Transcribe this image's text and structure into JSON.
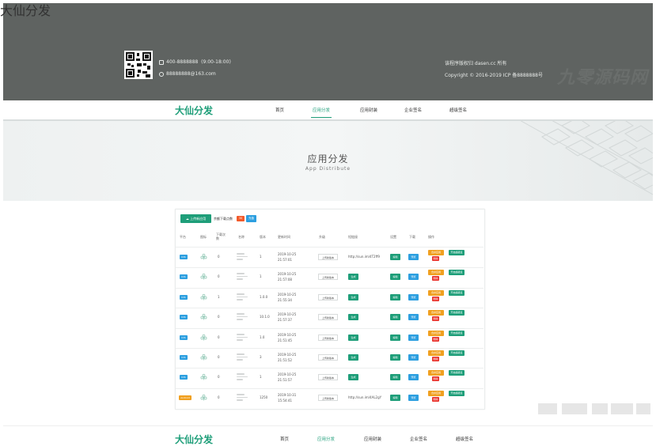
{
  "footer": {
    "brand": "大仙分发",
    "phone": "400-8888888",
    "hours": "(9:00-18:00)",
    "email": "88888888@163.com",
    "rights": "该程序版权归 dasen.cc 所有",
    "copyright": "Copyright © 2016-2019  ICP 备8888888号",
    "watermark": "九零源码网",
    "text_color": "#e8ebe9",
    "bg_color": "#5f6361"
  },
  "nav": {
    "logo": "大仙分发",
    "items": [
      "首页",
      "应用分发",
      "应用封装",
      "企业签名",
      "超级签名"
    ],
    "active_index": 1,
    "accent": "#1e9e79"
  },
  "banner": {
    "title": "应用分发",
    "subtitle": "App Distribute"
  },
  "toolbar": {
    "upload_label": "上传新应用",
    "remaining_text": "余额下载点数",
    "remaining_badge": "30",
    "recharge_label": "充值"
  },
  "table": {
    "headers": [
      "平台",
      "图标",
      "下载次数",
      "名称",
      "版本",
      "更新时间",
      "升级",
      "短链接",
      "设置",
      "下载",
      "操作"
    ],
    "rows": [
      {
        "platform": "IOS",
        "downloads": "0",
        "version": "1",
        "updated_date": "2019-10-25",
        "updated_time": "21:57:01",
        "upgrade": "上传新版本",
        "short": "http://sun.im/4T2ff9",
        "has_link": true
      },
      {
        "platform": "IOS",
        "downloads": "0",
        "version": "1",
        "updated_date": "2019-10-25",
        "updated_time": "21:57:08",
        "upgrade": "上传新版本",
        "short": "生成",
        "has_link": false
      },
      {
        "platform": "IOS",
        "downloads": "1",
        "version": "1.0.0",
        "updated_date": "2019-10-25",
        "updated_time": "21:55:34",
        "upgrade": "上传新版本",
        "short": "生成",
        "has_link": false
      },
      {
        "platform": "IOS",
        "downloads": "0",
        "version": "10.1.0",
        "updated_date": "2019-10-25",
        "updated_time": "21:57:37",
        "upgrade": "上传新版本",
        "short": "生成",
        "has_link": false
      },
      {
        "platform": "IOS",
        "downloads": "0",
        "version": "1.0",
        "updated_date": "2019-10-25",
        "updated_time": "21:51:45",
        "upgrade": "上传新版本",
        "short": "生成",
        "has_link": false
      },
      {
        "platform": "IOS",
        "downloads": "0",
        "version": "3",
        "updated_date": "2019-10-25",
        "updated_time": "21:51:52",
        "upgrade": "上传新版本",
        "short": "生成",
        "has_link": false
      },
      {
        "platform": "IOS",
        "downloads": "0",
        "version": "1",
        "updated_date": "2019-10-25",
        "updated_time": "21:51:57",
        "upgrade": "上传新版本",
        "short": "生成",
        "has_link": false
      },
      {
        "platform": "Android",
        "downloads": "0",
        "version": "1250",
        "updated_date": "2019-10-31",
        "updated_time": "15:54:41",
        "upgrade": "上传新版本",
        "short": "http://sun.im/4AL2gY",
        "has_link": true
      }
    ],
    "btn_edit": "编辑",
    "btn_preview": "预览",
    "btn_merge": "合并应用",
    "btn_super": "开启超级签",
    "btn_delete": "删除",
    "colors": {
      "ios": "#2c9fe0",
      "android": "#f0a020",
      "green": "#1e9e79",
      "red": "#e9302a"
    }
  },
  "bottom_nav": {
    "logo": "大仙分发",
    "items": [
      "首页",
      "应用分发",
      "应用封装",
      "企业签名",
      "超级签名"
    ],
    "active_index": 1
  }
}
